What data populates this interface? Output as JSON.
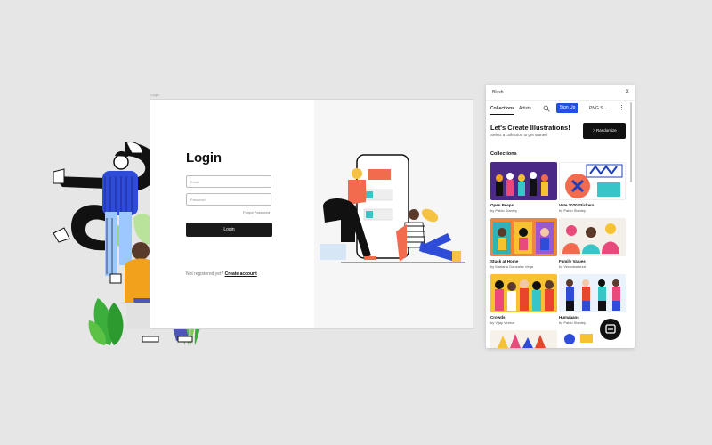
{
  "canvas": {
    "frame_label": "Login",
    "login": {
      "title": "Login",
      "email_placeholder": "Email",
      "password_placeholder": "Password",
      "forgot_password": "Forgot Password",
      "login_button": "Login",
      "not_registered": "Not registered yet?",
      "create_account": "Create account"
    }
  },
  "panel": {
    "title": "Blush",
    "tabs": [
      "Collections",
      "Artists"
    ],
    "signup_button": "Sign Up",
    "format_select": "PNG S",
    "heading": "Let's Create Illustrations!",
    "subheading": "Select a collection to get started",
    "randomize_button": "Randomize",
    "collections_label": "Collections",
    "collections": [
      {
        "name": "Open Peeps",
        "author": "by Pablo Stanley",
        "bg": "#4b2a86"
      },
      {
        "name": "Vote 2020 Stickers",
        "author": "by Pablo Stanley",
        "bg": "#ffffff"
      },
      {
        "name": "Stuck at Home",
        "author": "by Mariana Gonzalez Vega",
        "bg": "#f0863a"
      },
      {
        "name": "Family Values",
        "author": "by Veronica Iezzi",
        "bg": "#f4efe8"
      },
      {
        "name": "Crowds",
        "author": "by Vijay Verma",
        "bg": "#f7c232"
      },
      {
        "name": "Humaaans",
        "author": "by Pablo Stanley",
        "bg": "#eaf2fb"
      },
      {
        "name": "",
        "author": "",
        "bg": "#f6f2e9"
      },
      {
        "name": "",
        "author": "",
        "bg": "#ffffff"
      }
    ]
  }
}
